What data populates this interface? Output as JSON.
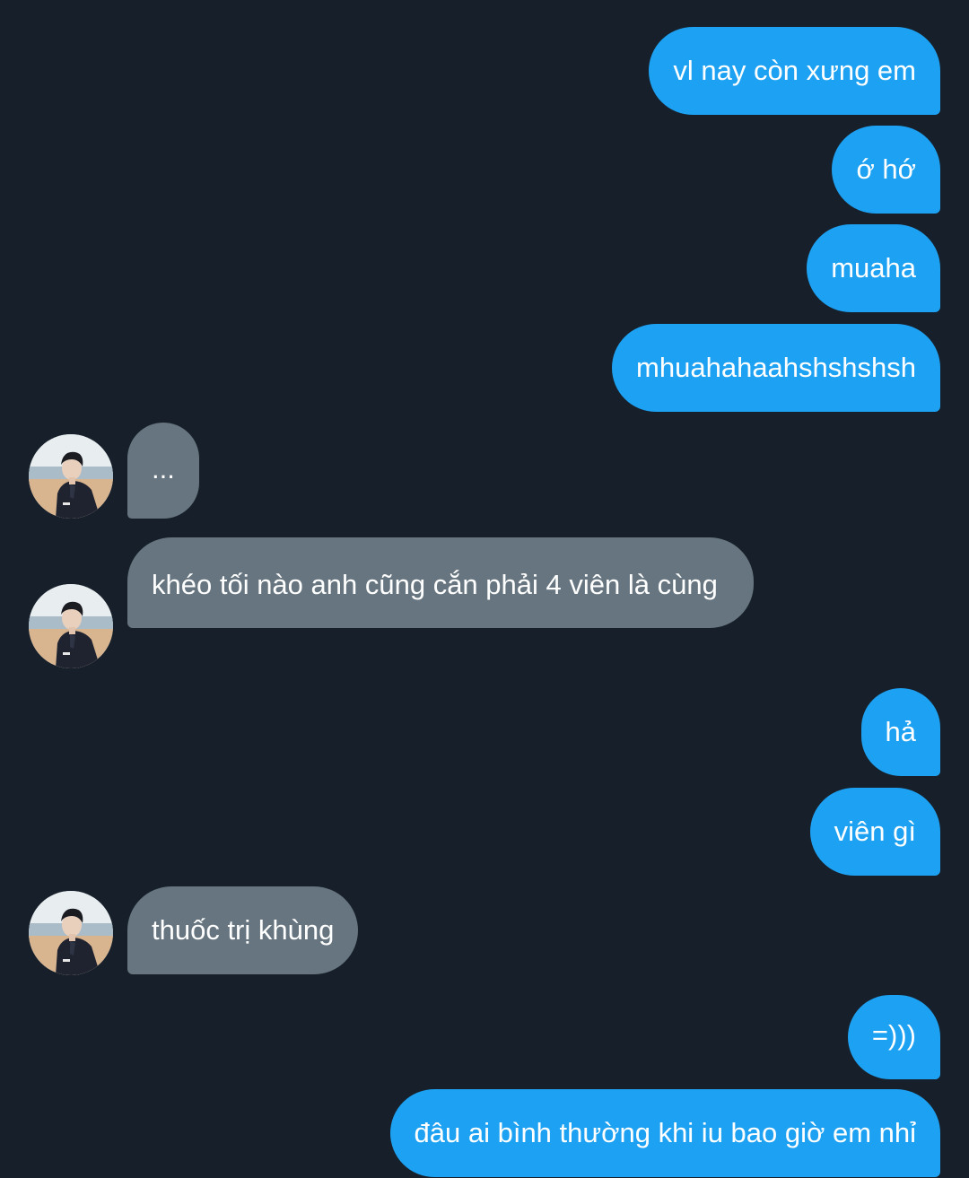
{
  "messages": [
    {
      "sender": "me",
      "text": "vl nay còn xưng em"
    },
    {
      "sender": "me",
      "text": "ớ hớ"
    },
    {
      "sender": "me",
      "text": "muaha"
    },
    {
      "sender": "me",
      "text": "mhuahahaahshshshsh"
    },
    {
      "sender": "other",
      "text": "..."
    },
    {
      "sender": "other",
      "text": "khéo tối nào anh cũng cắn phải 4 viên là cùng"
    },
    {
      "sender": "me",
      "text": "hả"
    },
    {
      "sender": "me",
      "text": "viên gì"
    },
    {
      "sender": "other",
      "text": "thuốc trị khùng"
    },
    {
      "sender": "me",
      "text": "=)))"
    },
    {
      "sender": "me",
      "text": "đâu ai bình thường khi iu bao giờ em nhỉ"
    }
  ],
  "colors": {
    "background": "#17202a",
    "outgoing_bubble": "#1da1f2",
    "incoming_bubble": "#66757f",
    "text": "#ffffff"
  },
  "icons": {
    "avatar": "contact-avatar-photo"
  }
}
